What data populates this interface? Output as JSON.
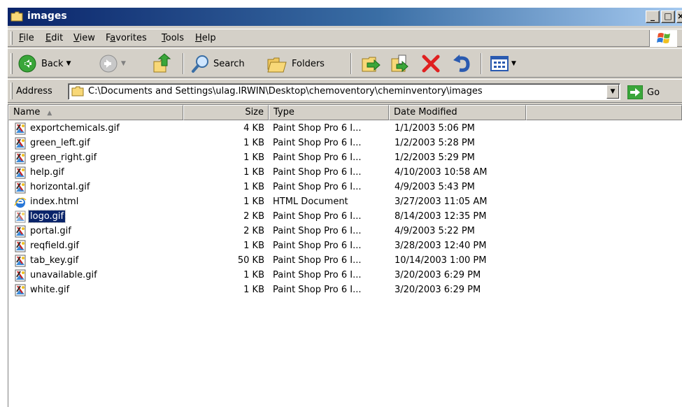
{
  "window": {
    "title": "images"
  },
  "menu": [
    {
      "label": "File",
      "key": "F",
      "rest": "ile"
    },
    {
      "label": "Edit",
      "key": "E",
      "rest": "dit"
    },
    {
      "label": "View",
      "key": "V",
      "rest": "iew"
    },
    {
      "label": "Favorites",
      "key": "a",
      "pre": "F",
      "rest": "vorites"
    },
    {
      "label": "Tools",
      "key": "T",
      "rest": "ools"
    },
    {
      "label": "Help",
      "key": "H",
      "rest": "elp"
    }
  ],
  "toolbar": {
    "back_label": "Back",
    "search_label": "Search",
    "folders_label": "Folders"
  },
  "address": {
    "label": "Address",
    "value": "C:\\Documents and Settings\\ulag.IRWIN\\Desktop\\chemoventory\\cheminventory\\images",
    "go_label": "Go"
  },
  "columns": {
    "name": "Name",
    "size": "Size",
    "type": "Type",
    "date": "Date Modified"
  },
  "files": [
    {
      "name": "exportchemicals.gif",
      "size": "4 KB",
      "type": "Paint Shop Pro 6 I...",
      "date": "1/1/2003 5:06 PM",
      "icon": "gif-file-icon"
    },
    {
      "name": "green_left.gif",
      "size": "1 KB",
      "type": "Paint Shop Pro 6 I...",
      "date": "1/2/2003 5:28 PM",
      "icon": "gif-file-icon"
    },
    {
      "name": "green_right.gif",
      "size": "1 KB",
      "type": "Paint Shop Pro 6 I...",
      "date": "1/2/2003 5:29 PM",
      "icon": "gif-file-icon"
    },
    {
      "name": "help.gif",
      "size": "1 KB",
      "type": "Paint Shop Pro 6 I...",
      "date": "4/10/2003 10:58 AM",
      "icon": "gif-file-icon"
    },
    {
      "name": "horizontal.gif",
      "size": "1 KB",
      "type": "Paint Shop Pro 6 I...",
      "date": "4/9/2003 5:43 PM",
      "icon": "gif-file-icon"
    },
    {
      "name": "index.html",
      "size": "1 KB",
      "type": "HTML Document",
      "date": "3/27/2003 11:05 AM",
      "icon": "ie-html-icon"
    },
    {
      "name": "logo.gif",
      "size": "2 KB",
      "type": "Paint Shop Pro 6 I...",
      "date": "8/14/2003 12:35 PM",
      "icon": "gif-file-icon",
      "selected": true
    },
    {
      "name": "portal.gif",
      "size": "2 KB",
      "type": "Paint Shop Pro 6 I...",
      "date": "4/9/2003 5:22 PM",
      "icon": "gif-file-icon"
    },
    {
      "name": "reqfield.gif",
      "size": "1 KB",
      "type": "Paint Shop Pro 6 I...",
      "date": "3/28/2003 12:40 PM",
      "icon": "gif-file-icon"
    },
    {
      "name": "tab_key.gif",
      "size": "50 KB",
      "type": "Paint Shop Pro 6 I...",
      "date": "10/14/2003 1:00 PM",
      "icon": "gif-file-icon"
    },
    {
      "name": "unavailable.gif",
      "size": "1 KB",
      "type": "Paint Shop Pro 6 I...",
      "date": "3/20/2003 6:29 PM",
      "icon": "gif-file-icon"
    },
    {
      "name": "white.gif",
      "size": "1 KB",
      "type": "Paint Shop Pro 6 I...",
      "date": "3/20/2003 6:29 PM",
      "icon": "gif-file-icon"
    }
  ],
  "colors": {
    "titlebar_start": "#0a246a",
    "titlebar_end": "#a6caf0",
    "selection": "#0a246a",
    "chrome": "#d4d0c8"
  }
}
